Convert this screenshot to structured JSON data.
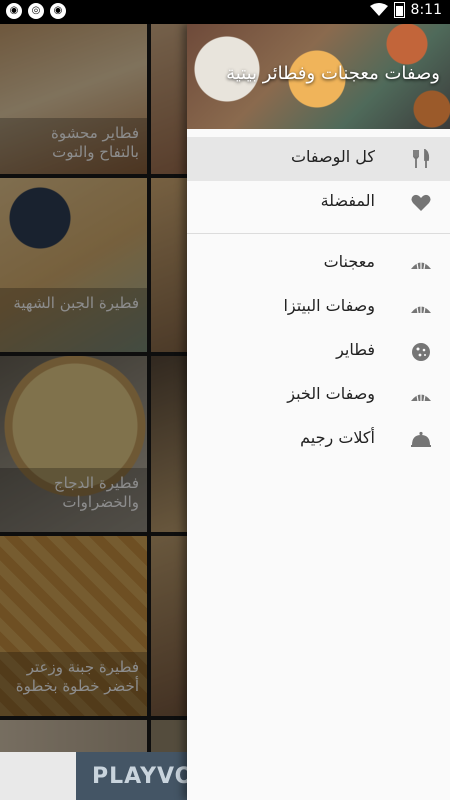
{
  "status_bar": {
    "time": "8:11"
  },
  "drawer": {
    "title": "وصفات معجنات وفطائر بيتية",
    "items_top": [
      {
        "label": "كل الوصفات",
        "icon": "fork-knife-icon",
        "active": true
      },
      {
        "label": "المفضلة",
        "icon": "heart-icon",
        "active": false
      }
    ],
    "items_categories": [
      {
        "label": "معجنات",
        "icon": "croissant-icon"
      },
      {
        "label": "وصفات البيتزا",
        "icon": "croissant-icon"
      },
      {
        "label": "فطاير",
        "icon": "cookie-icon"
      },
      {
        "label": "وصفات الخبز",
        "icon": "croissant-icon"
      },
      {
        "label": "أكلات رجيم",
        "icon": "cloche-icon"
      }
    ]
  },
  "recipes": [
    {
      "title": "فطاير محشوة بالتفاح والتوت"
    },
    {
      "title": "فطيرة الجبن الشهية"
    },
    {
      "title": "فطيرة الدجاج والخضراوات"
    },
    {
      "title": "فطيرة جبنة وزعتر أخضر خطوة بخطوة"
    }
  ],
  "ad": {
    "text": "PLAYVO"
  },
  "colors": {
    "icon_gray": "#757575",
    "active_bg": "#e6e6e6",
    "drawer_bg": "#fafafa"
  }
}
